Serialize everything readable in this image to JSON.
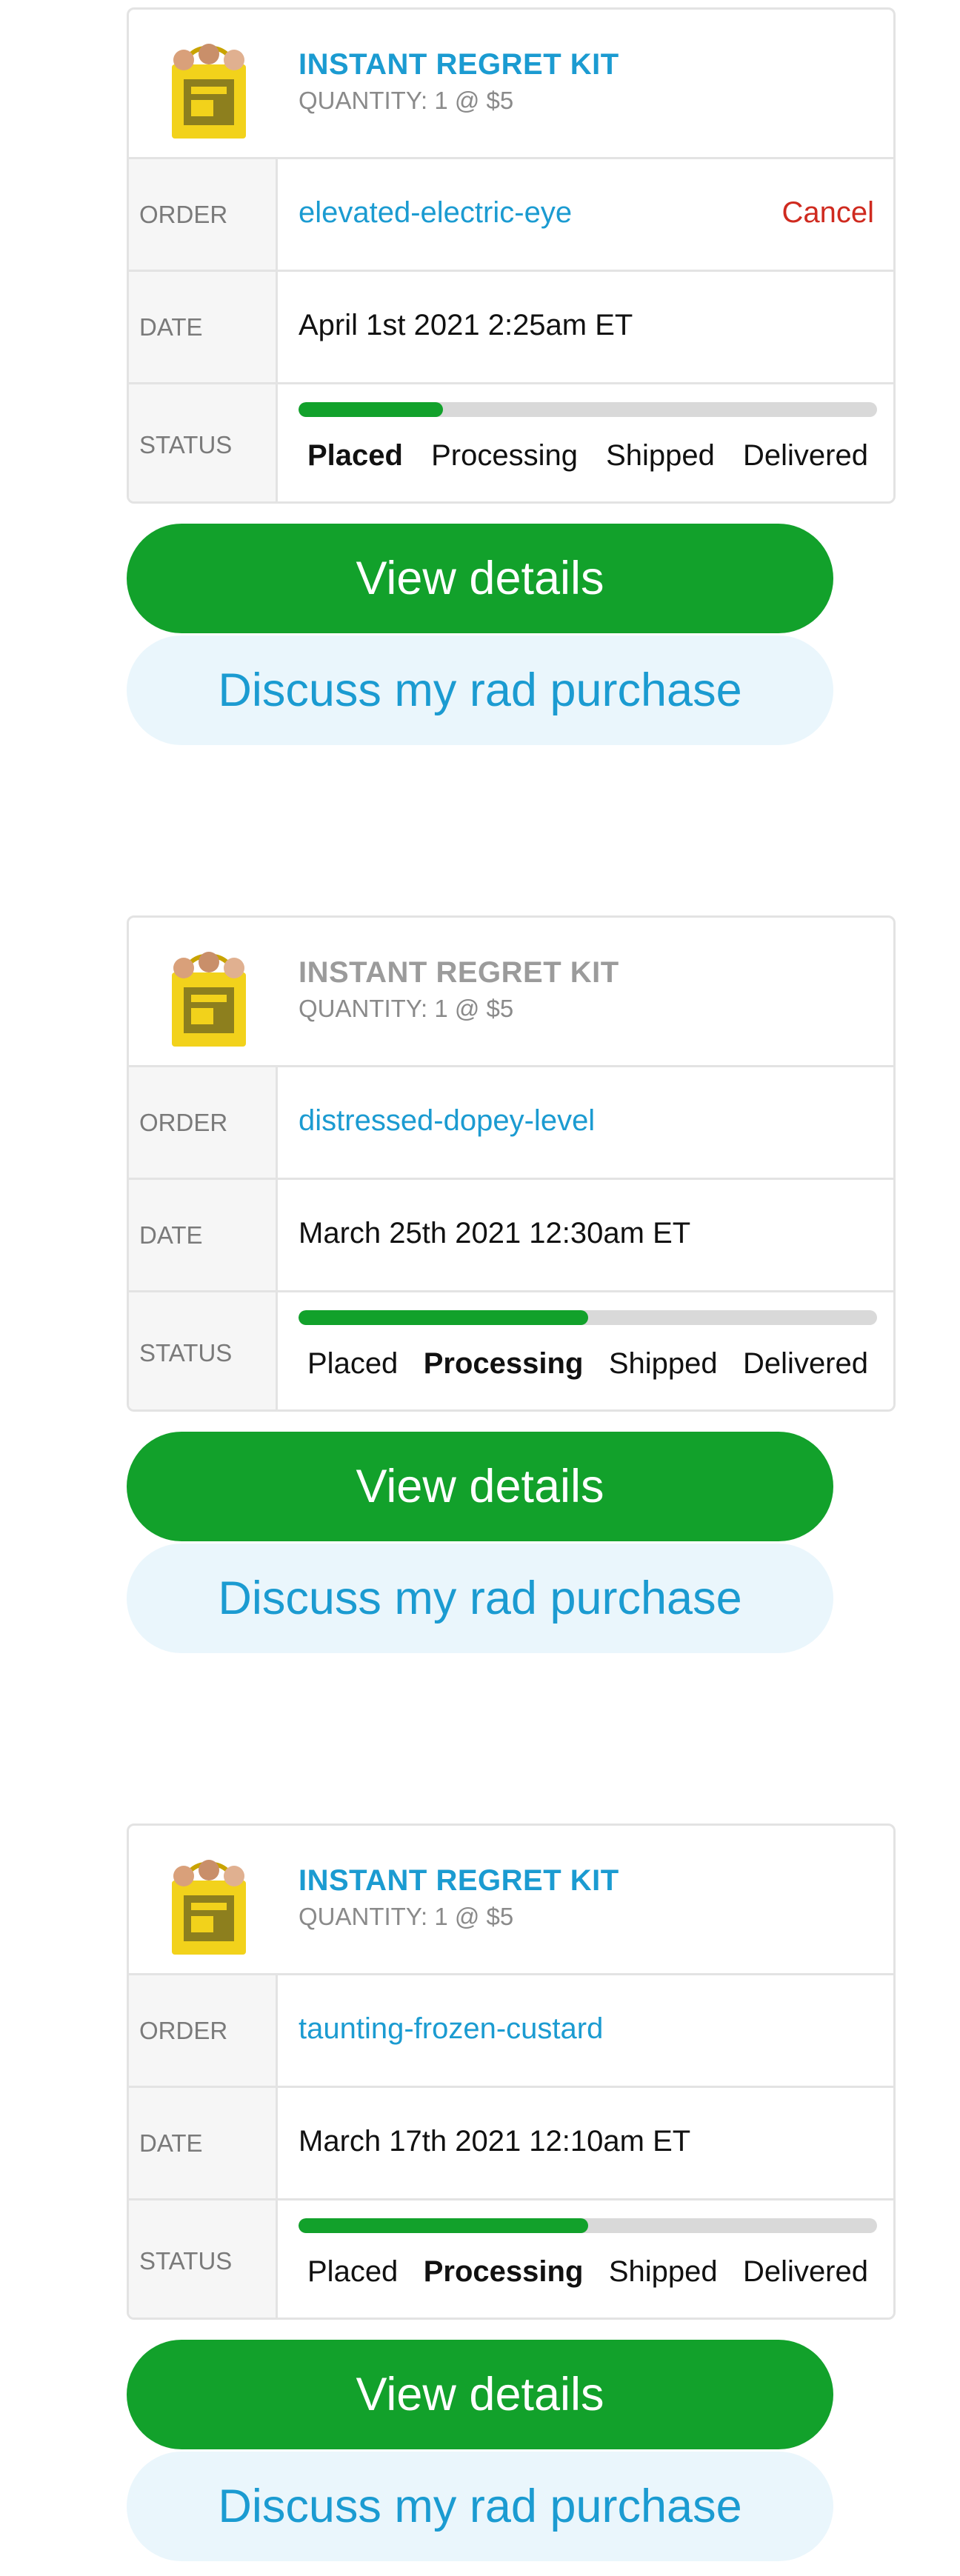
{
  "orders": [
    {
      "product_title": "INSTANT REGRET KIT",
      "quantity_text": "QUANTITY: 1 @ $5",
      "order_label": "ORDER",
      "order_id": "elevated-electric-eye",
      "cancel_label": "Cancel",
      "date_label": "DATE",
      "date": "April 1st 2021 2:25am ET",
      "status_label": "STATUS",
      "progress_fraction": 0.25,
      "steps": [
        "Placed",
        "Processing",
        "Shipped",
        "Delivered"
      ],
      "active_step": "Placed",
      "view_details_label": "View details",
      "discuss_label": "Discuss my rad purchase"
    },
    {
      "product_title": "INSTANT REGRET KIT",
      "quantity_text": "QUANTITY: 1 @ $5",
      "order_label": "ORDER",
      "order_id": "distressed-dopey-level",
      "date_label": "DATE",
      "date": "March 25th 2021 12:30am ET",
      "status_label": "STATUS",
      "progress_fraction": 0.5,
      "steps": [
        "Placed",
        "Processing",
        "Shipped",
        "Delivered"
      ],
      "active_step": "Processing",
      "view_details_label": "View details",
      "discuss_label": "Discuss my rad purchase"
    },
    {
      "product_title": "INSTANT REGRET KIT",
      "quantity_text": "QUANTITY: 1 @ $5",
      "order_label": "ORDER",
      "order_id": "taunting-frozen-custard",
      "date_label": "DATE",
      "date": "March 17th 2021 12:10am ET",
      "status_label": "STATUS",
      "progress_fraction": 0.5,
      "steps": [
        "Placed",
        "Processing",
        "Shipped",
        "Delivered"
      ],
      "active_step": "Processing",
      "view_details_label": "View details",
      "discuss_label": "Discuss my rad purchase"
    }
  ],
  "colors": {
    "accent_blue": "#1b9bd1",
    "primary_green": "#12a12b",
    "cancel_red": "#cf2a1f",
    "muted_gray": "#9b9b9b"
  },
  "icons": {
    "product_thumbnail": "yellow-tote-bag-icon"
  }
}
